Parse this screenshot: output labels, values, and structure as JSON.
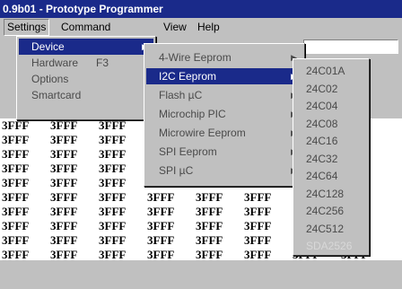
{
  "title": "0.9b01 - Prototype Programmer",
  "menubar": [
    {
      "label": "Settings"
    },
    {
      "label": "Command"
    },
    {
      "label": "View"
    },
    {
      "label": "Help"
    }
  ],
  "settings_menu": [
    {
      "label": "Device",
      "arrow": "▶"
    },
    {
      "label": "Hardware",
      "accel": "F3"
    },
    {
      "label": "Options"
    },
    {
      "label": "Smartcard"
    }
  ],
  "device_menu": [
    {
      "label": "4-Wire Eeprom",
      "arrow": "▶"
    },
    {
      "label": "I2C Eeprom",
      "arrow": "▶"
    },
    {
      "label": "Flash µC",
      "arrow": "▶"
    },
    {
      "label": "Microchip PIC",
      "arrow": "▶"
    },
    {
      "label": "Microwire Eeprom",
      "arrow": "▶"
    },
    {
      "label": "SPI Eeprom",
      "arrow": "▶"
    },
    {
      "label": "SPI µC",
      "arrow": "▶"
    }
  ],
  "i2c_menu": [
    "24C01A",
    "24C02",
    "24C04",
    "24C08",
    "24C16",
    "24C32",
    "24C64",
    "24C128",
    "24C256",
    "24C512",
    "SDA2526"
  ],
  "hex_cell": "3FFF"
}
